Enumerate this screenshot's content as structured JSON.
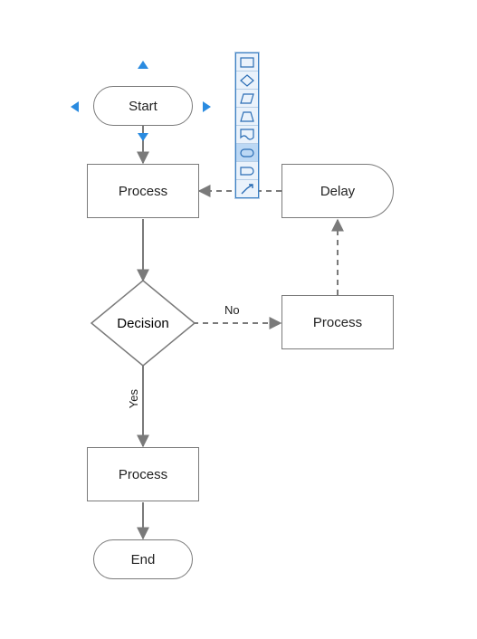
{
  "nodes": {
    "start": "Start",
    "process1": "Process",
    "decision": "Decision",
    "process_right": "Process",
    "delay": "Delay",
    "process_yes": "Process",
    "end": "End"
  },
  "edges": {
    "no_label": "No",
    "yes_label": "Yes"
  },
  "palette": {
    "items": [
      {
        "name": "rect-icon"
      },
      {
        "name": "diamond-icon"
      },
      {
        "name": "parallelogram-icon"
      },
      {
        "name": "trapezoid-icon"
      },
      {
        "name": "document-icon"
      },
      {
        "name": "terminator-icon"
      },
      {
        "name": "delay-shape-icon"
      },
      {
        "name": "connector-arrow-icon"
      }
    ],
    "selected_index": 5
  },
  "chart_data": {
    "type": "flowchart",
    "nodes": [
      {
        "id": "start",
        "type": "terminator",
        "label": "Start"
      },
      {
        "id": "p1",
        "type": "process",
        "label": "Process"
      },
      {
        "id": "decision",
        "type": "decision",
        "label": "Decision"
      },
      {
        "id": "p_no",
        "type": "process",
        "label": "Process"
      },
      {
        "id": "delay",
        "type": "delay",
        "label": "Delay"
      },
      {
        "id": "p_yes",
        "type": "process",
        "label": "Process"
      },
      {
        "id": "end",
        "type": "terminator",
        "label": "End"
      }
    ],
    "edges": [
      {
        "from": "start",
        "to": "p1",
        "style": "solid"
      },
      {
        "from": "p1",
        "to": "decision",
        "style": "solid"
      },
      {
        "from": "decision",
        "to": "p_no",
        "style": "dashed",
        "label": "No"
      },
      {
        "from": "p_no",
        "to": "delay",
        "style": "dashed"
      },
      {
        "from": "delay",
        "to": "p1",
        "style": "dashed"
      },
      {
        "from": "decision",
        "to": "p_yes",
        "style": "solid",
        "label": "Yes"
      },
      {
        "from": "p_yes",
        "to": "end",
        "style": "solid"
      }
    ]
  }
}
